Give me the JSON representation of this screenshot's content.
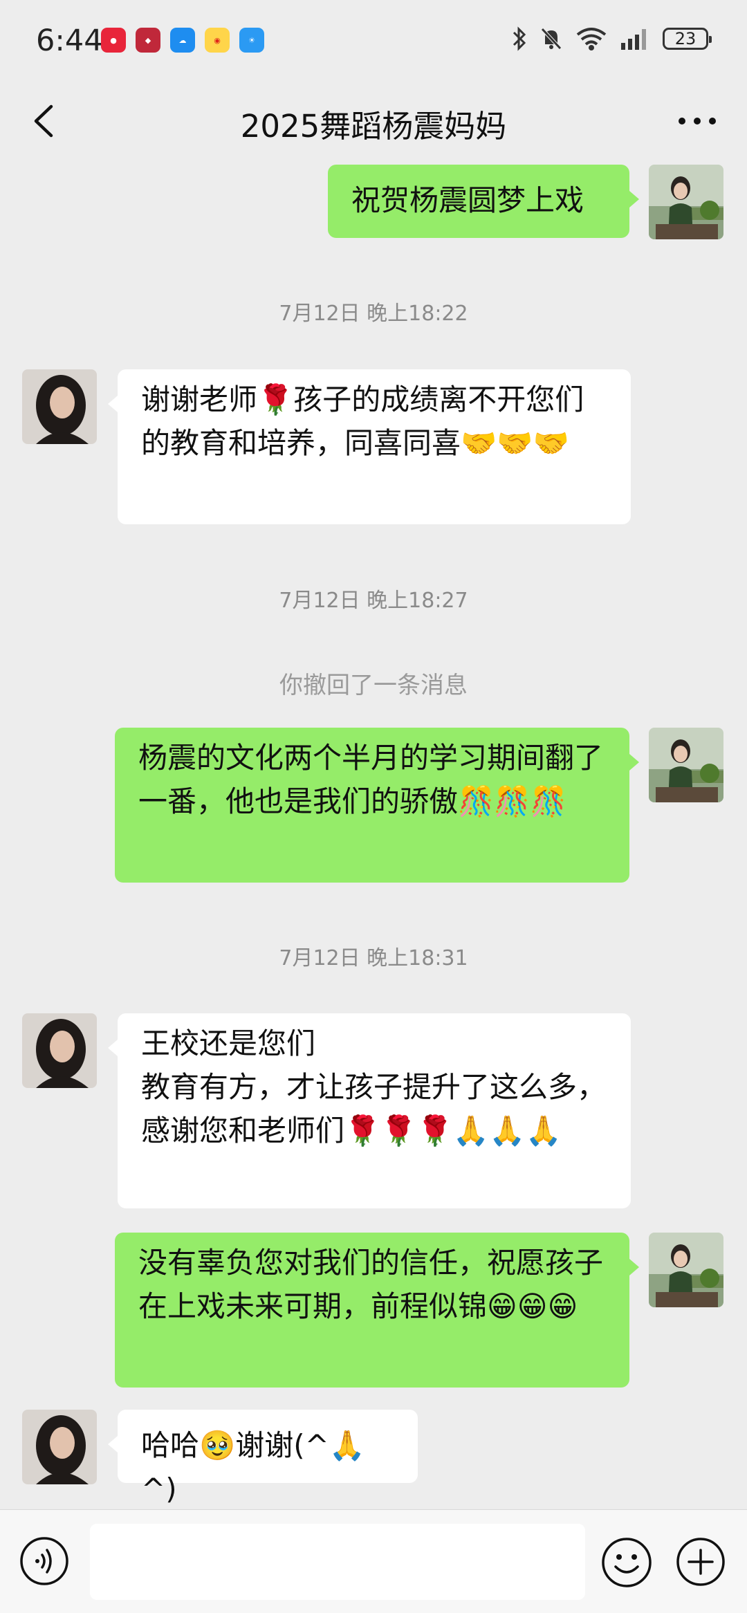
{
  "status_bar": {
    "time": "6:44",
    "battery": "23",
    "app_icons": [
      "ali-app-icon",
      "game-app-icon",
      "cloud-app-icon",
      "weibo-icon",
      "weather-icon"
    ]
  },
  "header": {
    "title": "2025舞蹈杨震妈妈"
  },
  "messages": {
    "m0": {
      "text": "祝贺杨震圆梦上戏",
      "sender": "me"
    },
    "t1": "7月12日 晚上18:22",
    "m1": {
      "text": "谢谢老师🌹孩子的成绩离不开您们的教育和培养，同喜同喜🤝🤝🤝",
      "sender": "other"
    },
    "t2": "7月12日 晚上18:27",
    "recall": "你撤回了一条消息",
    "m2": {
      "text": "杨震的文化两个半月的学习期间翻了一番，他也是我们的骄傲🎊🎊🎊",
      "sender": "me"
    },
    "t3": "7月12日 晚上18:31",
    "m3": {
      "text": "王校还是您们\n教育有方，才让孩子提升了这么多，感谢您和老师们🌹🌹🌹🙏🙏🙏",
      "sender": "other"
    },
    "m4": {
      "text": "没有辜负您对我们的信任，祝愿孩子在上戏未来可期，前程似锦😁😁😁",
      "sender": "me"
    },
    "m5": {
      "text": "哈哈🥹谢谢(^🙏^)",
      "sender": "other"
    }
  },
  "input_bar": {
    "placeholder": ""
  },
  "colors": {
    "background": "#ededed",
    "outgoing_bubble": "#95ec69",
    "incoming_bubble": "#ffffff"
  }
}
